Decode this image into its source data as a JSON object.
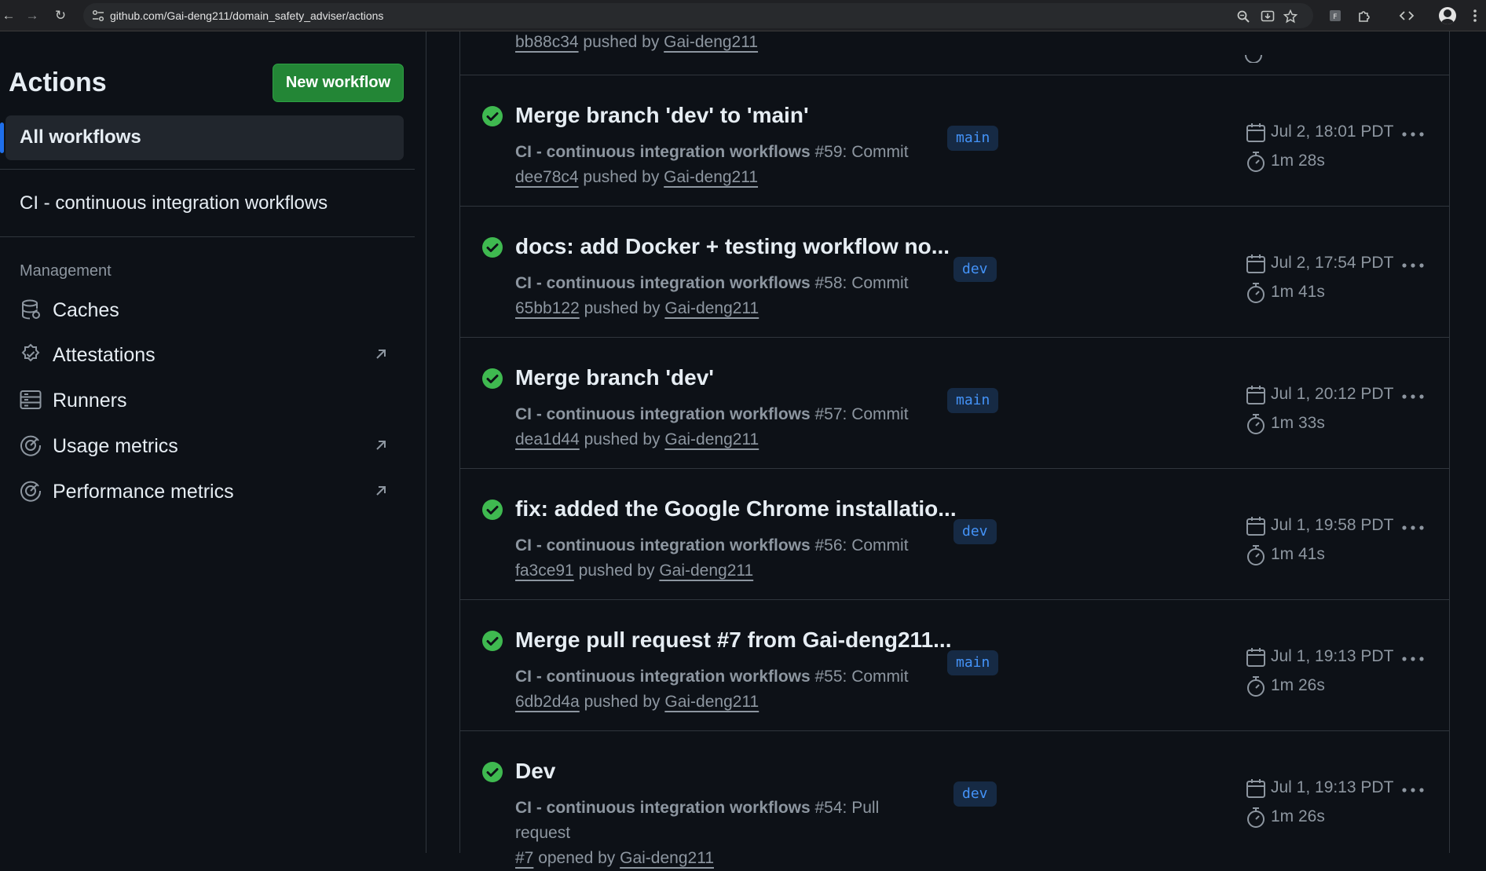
{
  "browser": {
    "url": "github.com/Gai-deng211/domain_safety_adviser/actions"
  },
  "sidebar": {
    "title": "Actions",
    "new_workflow_label": "New workflow",
    "all_workflows_label": "All workflows",
    "workflows": [
      "CI - continuous integration workflows"
    ],
    "management_heading": "Management",
    "management_items": [
      {
        "label": "Caches",
        "icon": "database-icon",
        "external": false
      },
      {
        "label": "Attestations",
        "icon": "verified-icon",
        "external": true
      },
      {
        "label": "Runners",
        "icon": "server-icon",
        "external": false
      },
      {
        "label": "Usage metrics",
        "icon": "meter-icon",
        "external": true
      },
      {
        "label": "Performance metrics",
        "icon": "meter-icon",
        "external": true
      }
    ]
  },
  "partial_row": {
    "commit": "bb88c34",
    "pushed_by_text": " pushed by ",
    "user": "Gai-deng211"
  },
  "runs": [
    {
      "title": "Merge branch 'dev' to 'main'",
      "workflow": "CI - continuous integration workflows",
      "run_text": " #59: Commit",
      "ref": "dee78c4",
      "action_text": " pushed by ",
      "user": "Gai-deng211",
      "branch": "main",
      "date": "Jul 2, 18:01 PDT",
      "duration": "1m 28s",
      "status": "success"
    },
    {
      "title": "docs: add Docker + testing workflow no...",
      "workflow": "CI - continuous integration workflows",
      "run_text": " #58: Commit",
      "ref": "65bb122",
      "action_text": " pushed by ",
      "user": "Gai-deng211",
      "branch": "dev",
      "date": "Jul 2, 17:54 PDT",
      "duration": "1m 41s",
      "status": "success"
    },
    {
      "title": "Merge branch 'dev'",
      "workflow": "CI - continuous integration workflows",
      "run_text": " #57: Commit",
      "ref": "dea1d44",
      "action_text": " pushed by ",
      "user": "Gai-deng211",
      "branch": "main",
      "date": "Jul 1, 20:12 PDT",
      "duration": "1m 33s",
      "status": "success"
    },
    {
      "title": "fix: added the Google Chrome installatio...",
      "workflow": "CI - continuous integration workflows",
      "run_text": " #56: Commit",
      "ref": "fa3ce91",
      "action_text": " pushed by ",
      "user": "Gai-deng211",
      "branch": "dev",
      "date": "Jul 1, 19:58 PDT",
      "duration": "1m 41s",
      "status": "success"
    },
    {
      "title": "Merge pull request #7 from Gai-deng211...",
      "workflow": "CI - continuous integration workflows",
      "run_text": " #55: Commit",
      "ref": "6db2d4a",
      "action_text": " pushed by ",
      "user": "Gai-deng211",
      "branch": "main",
      "date": "Jul 1, 19:13 PDT",
      "duration": "1m 26s",
      "status": "success"
    },
    {
      "title": "Dev",
      "workflow": "CI - continuous integration workflows",
      "run_text": " #54: Pull request",
      "ref": "#7",
      "action_text": " opened by ",
      "user": "Gai-deng211",
      "branch": "dev",
      "date": "Jul 1, 19:13 PDT",
      "duration": "1m 26s",
      "status": "success"
    }
  ],
  "colors": {
    "success": "#3fb950",
    "accent": "#1f6feb",
    "primary_button": "#238636"
  }
}
